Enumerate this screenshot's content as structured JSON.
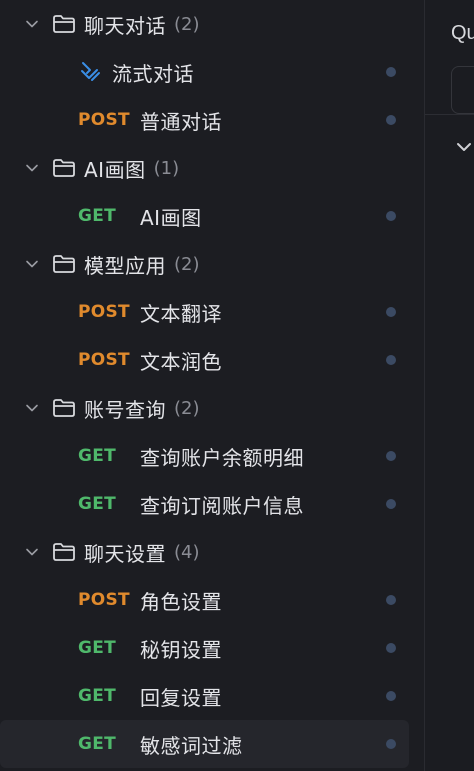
{
  "tree": {
    "groups": [
      {
        "name": "聊天对话",
        "count": "(2)",
        "items": [
          {
            "method": "",
            "icon": "stream-icon",
            "name": "流式对话"
          },
          {
            "method": "POST",
            "name": "普通对话"
          }
        ]
      },
      {
        "name": "AI画图",
        "count": "(1)",
        "items": [
          {
            "method": "GET",
            "name": "AI画图"
          }
        ]
      },
      {
        "name": "模型应用",
        "count": "(2)",
        "items": [
          {
            "method": "POST",
            "name": "文本翻译"
          },
          {
            "method": "POST",
            "name": "文本润色"
          }
        ]
      },
      {
        "name": "账号查询",
        "count": "(2)",
        "items": [
          {
            "method": "GET",
            "name": "查询账户余额明细"
          },
          {
            "method": "GET",
            "name": "查询订阅账户信息"
          }
        ]
      },
      {
        "name": "聊天设置",
        "count": "(4)",
        "items": [
          {
            "method": "POST",
            "name": "角色设置"
          },
          {
            "method": "GET",
            "name": "秘钥设置"
          },
          {
            "method": "GET",
            "name": "回复设置"
          },
          {
            "method": "GET",
            "name": "敏感词过滤",
            "selected": true
          }
        ]
      }
    ]
  },
  "right_panel": {
    "tab_text": "Qu"
  },
  "colors": {
    "post": "#e08a2d",
    "get": "#4fb86b",
    "status_dot": "#3b4a63",
    "selected_bg": "#25262c"
  }
}
